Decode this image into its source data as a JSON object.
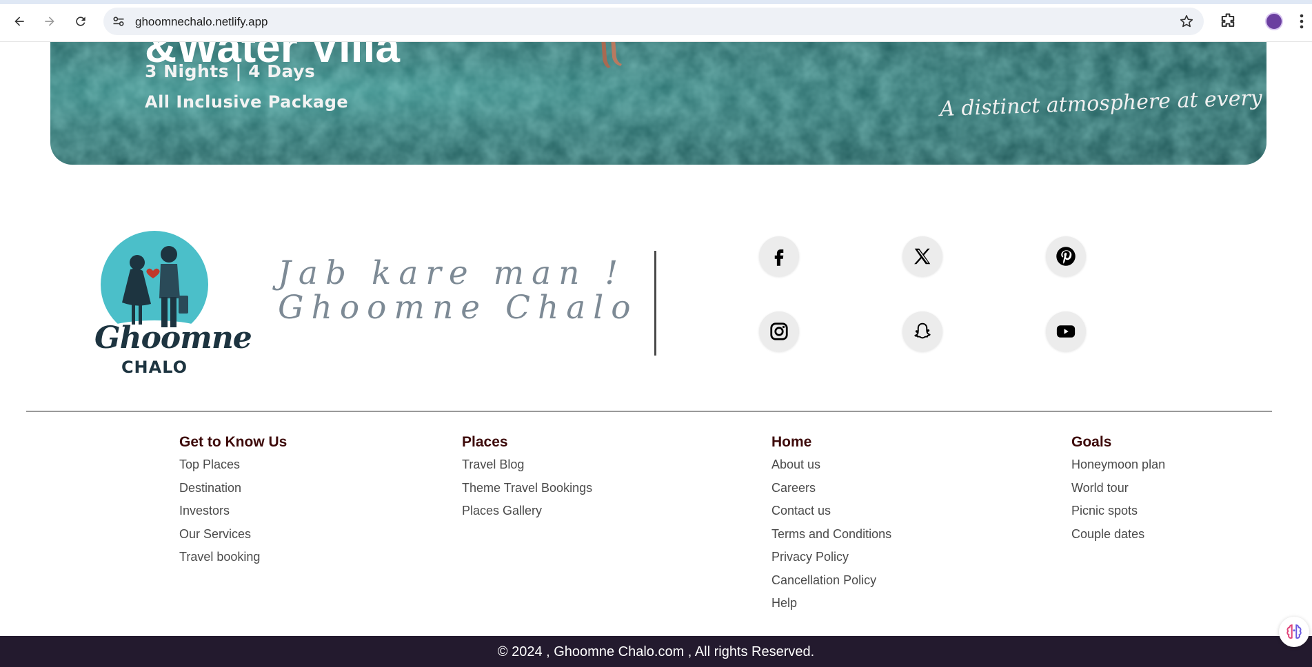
{
  "browser": {
    "url": "ghoomnechalo.netlify.app"
  },
  "banner": {
    "title_cut": "&Water Villa",
    "nights": "3 Nights | 4 Days",
    "package": "All Inclusive Package",
    "tagline": "A distinct atmosphere at every Resort"
  },
  "brand": {
    "logo_text_1": "Ghoomne",
    "logo_text_2": "CHALO",
    "slogan_line1": "Jab kare man !",
    "slogan_line2": "Ghoomne Chalo"
  },
  "social": [
    "facebook-icon",
    "x-icon",
    "pinterest-icon",
    "instagram-icon",
    "snapchat-icon",
    "youtube-icon"
  ],
  "footer": {
    "columns": [
      {
        "title": "Get to Know Us",
        "links": [
          "Top Places",
          "Destination",
          "Investors",
          "Our Services",
          "Travel booking"
        ]
      },
      {
        "title": "Places",
        "links": [
          "Travel Blog",
          "Theme Travel Bookings",
          "Places Gallery"
        ]
      },
      {
        "title": "Home",
        "links": [
          "About us",
          "Careers",
          "Contact us",
          "Terms and Conditions",
          "Privacy Policy",
          "Cancellation Policy",
          "Help"
        ]
      },
      {
        "title": "Goals",
        "links": [
          "Honeymoon plan",
          "World tour",
          "Picnic spots",
          "Couple dates"
        ]
      }
    ],
    "copyright": "© 2024 , Ghoomne Chalo.com , All rights Reserved."
  },
  "colors": {
    "column_title": "#3d0a0a",
    "copy_bar": "#231a2e",
    "banner_teal": "#2b6e6d",
    "slogan": "#7d8a95"
  }
}
